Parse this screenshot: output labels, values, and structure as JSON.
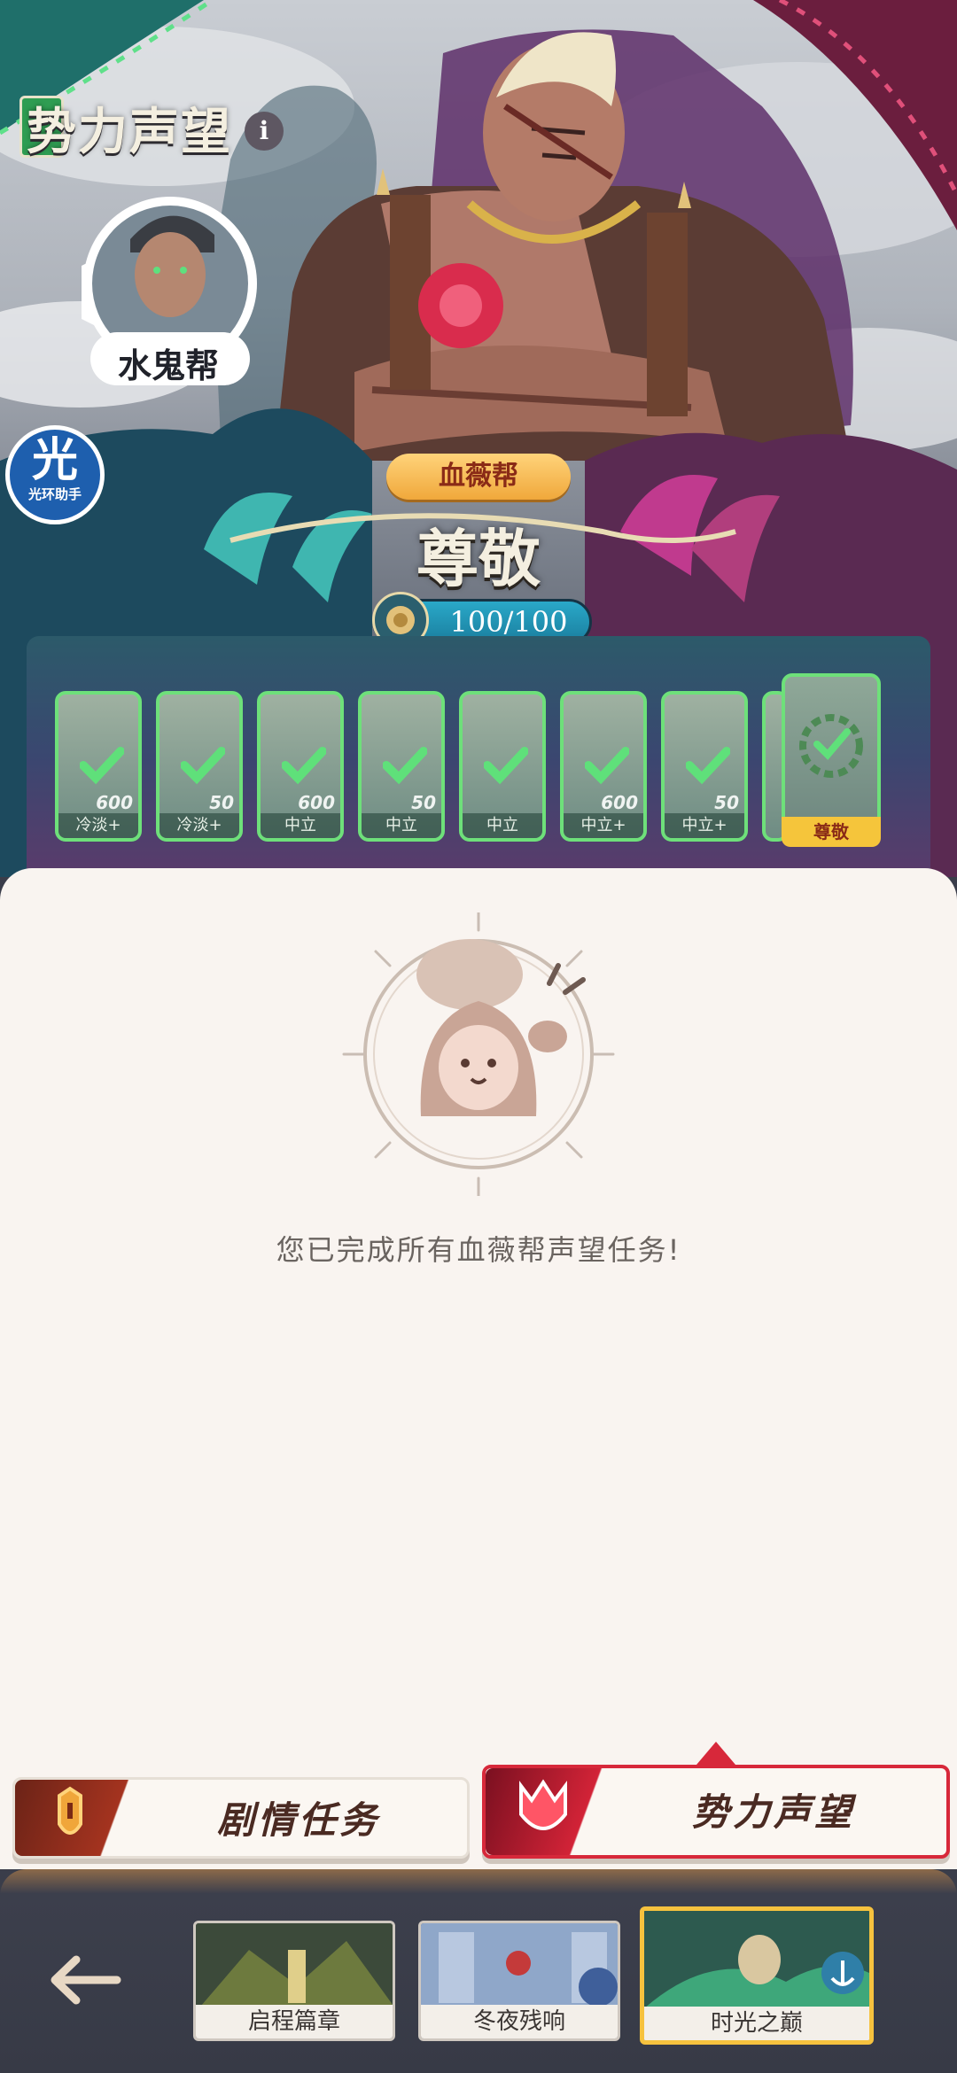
{
  "page": {
    "title": "势力声望",
    "info_icon": "i"
  },
  "npc": {
    "name": "水鬼帮"
  },
  "assistant": {
    "glyph": "光",
    "label": "光环助手"
  },
  "faction": {
    "name": "血薇帮",
    "rank": "尊敬",
    "progress_text": "100/100",
    "progress_fraction": 1.0
  },
  "rewards": [
    {
      "label": "冷淡+",
      "amount": "600",
      "completed": true
    },
    {
      "label": "冷淡+",
      "amount": "50",
      "completed": true
    },
    {
      "label": "中立",
      "amount": "600",
      "completed": true
    },
    {
      "label": "中立",
      "amount": "50",
      "completed": true
    },
    {
      "label": "中立",
      "amount": "",
      "completed": true
    },
    {
      "label": "中立+",
      "amount": "600",
      "completed": true
    },
    {
      "label": "中立+",
      "amount": "50",
      "completed": true
    }
  ],
  "final_reward": {
    "label": "尊敬",
    "completed": true
  },
  "message": "您已完成所有血薇帮声望任务!",
  "tabs": {
    "story": "剧情任务",
    "faction": "势力声望",
    "selected": "faction"
  },
  "chapters": [
    {
      "label": "启程篇章",
      "selected": false
    },
    {
      "label": "冬夜残响",
      "selected": false
    },
    {
      "label": "时光之巅",
      "selected": true
    }
  ],
  "colors": {
    "accent_red": "#d7283a",
    "check_green": "#6ee07a",
    "rank_tag": "#f5c53b"
  }
}
